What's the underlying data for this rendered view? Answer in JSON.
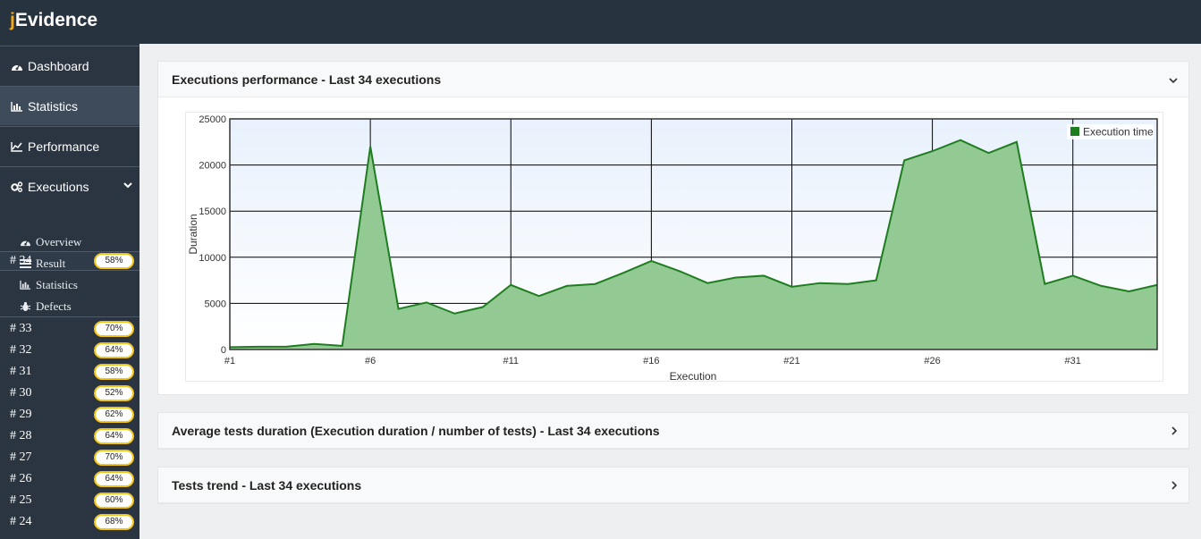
{
  "app": {
    "brand_first": "j",
    "brand_rest": "Evidence"
  },
  "sidebar": {
    "items": [
      {
        "label": "Dashboard",
        "icon": "dashboard-icon"
      },
      {
        "label": "Statistics",
        "icon": "bar-chart-icon"
      },
      {
        "label": "Performance",
        "icon": "line-chart-icon"
      },
      {
        "label": "Executions",
        "icon": "gears-icon"
      }
    ],
    "current_execution": {
      "hash": "#",
      "number": "34",
      "badge": "58%"
    },
    "sub_items": [
      {
        "label": "Overview",
        "icon": "dashboard-icon"
      },
      {
        "label": "Result",
        "icon": "list-icon"
      },
      {
        "label": "Statistics",
        "icon": "bar-chart-icon"
      },
      {
        "label": "Defects",
        "icon": "bug-icon"
      }
    ],
    "executions": [
      {
        "number": "33",
        "badge": "70%"
      },
      {
        "number": "32",
        "badge": "64%"
      },
      {
        "number": "31",
        "badge": "58%"
      },
      {
        "number": "30",
        "badge": "52%"
      },
      {
        "number": "29",
        "badge": "62%"
      },
      {
        "number": "28",
        "badge": "64%"
      },
      {
        "number": "27",
        "badge": "70%"
      },
      {
        "number": "26",
        "badge": "64%"
      },
      {
        "number": "25",
        "badge": "60%"
      },
      {
        "number": "24",
        "badge": "68%"
      }
    ]
  },
  "panels": [
    {
      "title": "Executions performance - Last 34 executions",
      "expanded": true
    },
    {
      "title": "Average tests duration (Execution duration / number of tests) - Last 34 executions",
      "expanded": false
    },
    {
      "title": "Tests trend - Last 34 executions",
      "expanded": false
    }
  ],
  "colors": {
    "series_line": "#1e7d1e",
    "series_fill": "#93c993",
    "badge_border": "#f0c419",
    "topbar": "#283340",
    "brand_accent": "#f0a81c"
  },
  "chart_data": {
    "type": "area",
    "xlabel": "Execution",
    "ylabel": "Duration",
    "ylim": [
      0,
      25000
    ],
    "yticks": [
      0,
      5000,
      10000,
      15000,
      20000,
      25000
    ],
    "xticks": [
      1,
      6,
      11,
      16,
      21,
      26,
      31
    ],
    "xtick_prefix": "#",
    "legend": "top-right",
    "grid": true,
    "series": [
      {
        "name": "Execution time",
        "x": [
          1,
          2,
          3,
          4,
          5,
          6,
          7,
          8,
          9,
          10,
          11,
          12,
          13,
          14,
          15,
          16,
          17,
          18,
          19,
          20,
          21,
          22,
          23,
          24,
          25,
          26,
          27,
          28,
          29,
          30,
          31,
          32,
          33,
          34
        ],
        "values": [
          250,
          300,
          300,
          600,
          400,
          22000,
          4400,
          5100,
          3900,
          4600,
          7000,
          5800,
          6900,
          7100,
          8300,
          9600,
          8500,
          7200,
          7800,
          8000,
          6800,
          7200,
          7100,
          7500,
          20500,
          21500,
          22700,
          21300,
          22500,
          7100,
          8000,
          6900,
          6300,
          7000
        ]
      }
    ]
  }
}
